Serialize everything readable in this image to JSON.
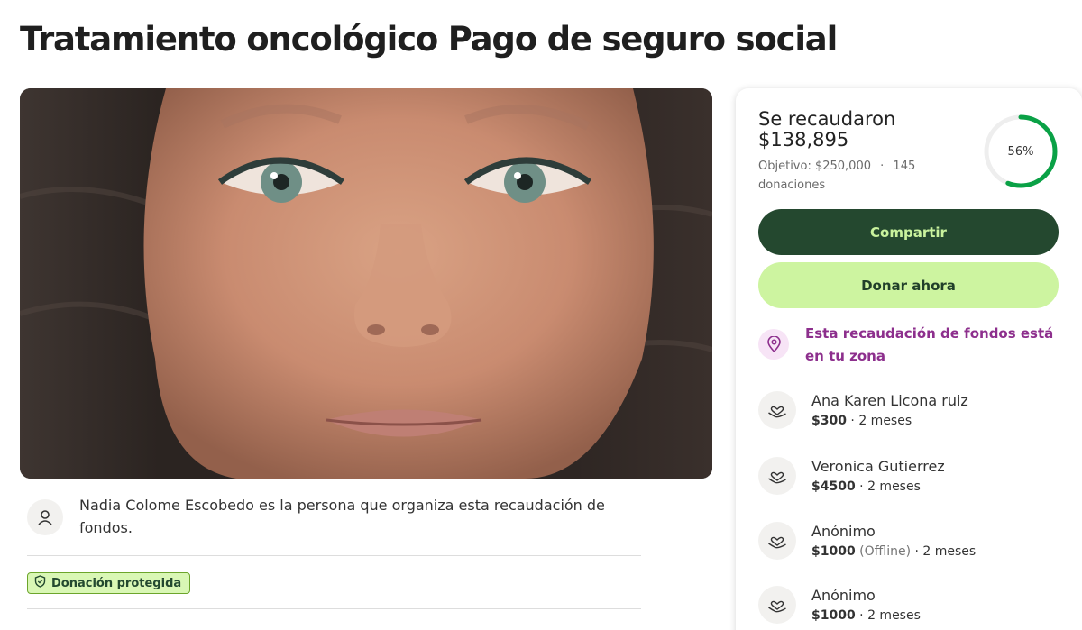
{
  "campaign": {
    "title": "Tratamiento oncológico Pago de seguro social"
  },
  "organizer": {
    "text": "Nadia Colome Escobedo es la persona que organiza esta recaudación de fondos."
  },
  "badge": {
    "label": "Donación protegida"
  },
  "progress": {
    "raised_label": "Se recaudaron",
    "raised_amount": "$138,895",
    "goal_text": "Objetivo: $250,000",
    "separator": "·",
    "donations_text": "145 donaciones",
    "percent_label": "56%",
    "fraction": 0.56,
    "ring_color": "#0aa146",
    "ring_track_color": "#eeeeee"
  },
  "actions": {
    "share_label": "Compartir",
    "donate_label": "Donar ahora"
  },
  "local_notice": {
    "text": "Esta recaudación de fondos está en tu zona"
  },
  "donations": [
    {
      "name": "Ana Karen Licona ruiz",
      "amount": "$300",
      "offline": "",
      "time": "2 meses"
    },
    {
      "name": "Veronica Gutierrez",
      "amount": "$4500",
      "offline": "",
      "time": "2 meses"
    },
    {
      "name": "Anónimo",
      "amount": "$1000",
      "offline": "(Offline)",
      "time": "2 meses"
    },
    {
      "name": "Anónimo",
      "amount": "$1000",
      "offline": "",
      "time": "2 meses"
    }
  ],
  "colors": {
    "brand_dark": "#24482f",
    "brand_light": "#cdf4a0",
    "local_accent": "#8d2f8d"
  },
  "icons": {
    "organizer": "user-icon",
    "badge": "shield-icon",
    "local": "location-pin-icon",
    "donation": "heart-hand-icon"
  }
}
